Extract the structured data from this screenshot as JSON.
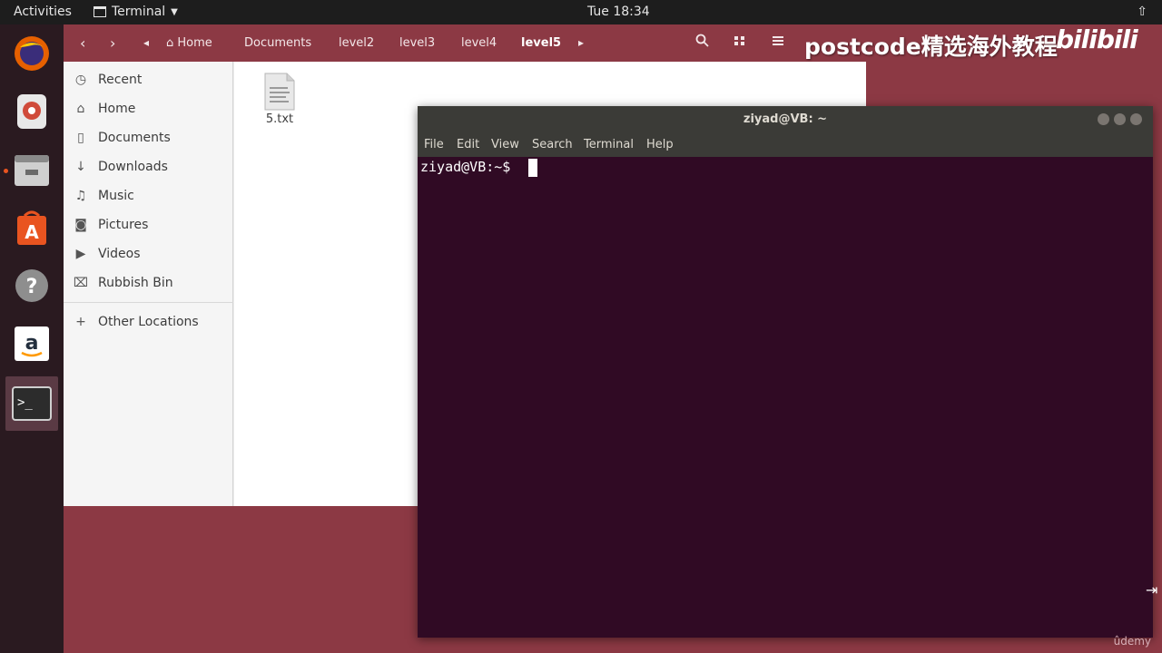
{
  "topbar": {
    "activities": "Activities",
    "app_name": "Terminal",
    "clock": "Tue 18:34"
  },
  "dock": {
    "items": [
      "firefox-icon",
      "rhythmbox-icon",
      "files-icon",
      "software-icon",
      "help-icon",
      "amazon-icon",
      "terminal-icon"
    ]
  },
  "files": {
    "breadcrumbs": [
      "Home",
      "Documents",
      "level2",
      "level3",
      "level4",
      "level5"
    ],
    "sidebar": {
      "items": [
        {
          "label": "Recent",
          "icon": "clock-icon"
        },
        {
          "label": "Home",
          "icon": "home-icon"
        },
        {
          "label": "Documents",
          "icon": "document-icon"
        },
        {
          "label": "Downloads",
          "icon": "download-icon"
        },
        {
          "label": "Music",
          "icon": "music-icon"
        },
        {
          "label": "Pictures",
          "icon": "camera-icon"
        },
        {
          "label": "Videos",
          "icon": "video-icon"
        },
        {
          "label": "Rubbish Bin",
          "icon": "trash-icon"
        }
      ],
      "other_locations": "Other Locations"
    },
    "file": {
      "name": "5.txt"
    }
  },
  "watermark": {
    "text": "postcode精选海外教程",
    "brand": "bilibili"
  },
  "terminal": {
    "title": "ziyad@VB: ~",
    "menu": [
      "File",
      "Edit",
      "View",
      "Search",
      "Terminal",
      "Help"
    ],
    "prompt": "ziyad@VB:~$ "
  },
  "udemy": "ûdemy",
  "colors": {
    "desktop": "#8c3944",
    "terminal_bg": "#300a24",
    "accent": "#e95420"
  }
}
